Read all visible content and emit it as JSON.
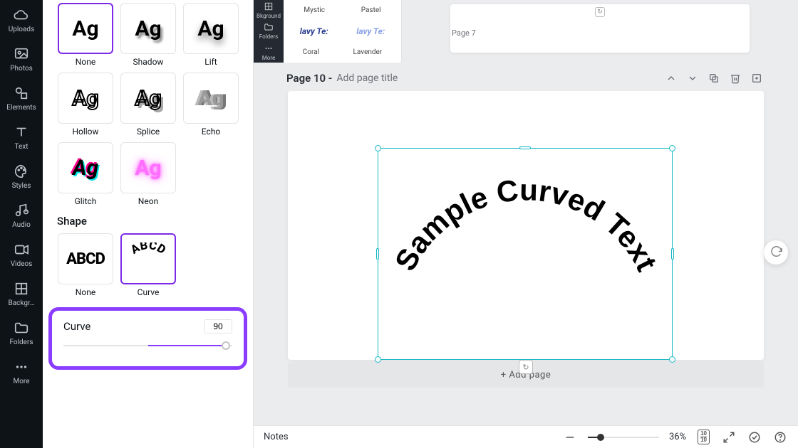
{
  "rail": [
    {
      "label": "Uploads",
      "icon": "cloud"
    },
    {
      "label": "Photos",
      "icon": "image"
    },
    {
      "label": "Elements",
      "icon": "shapes"
    },
    {
      "label": "Text",
      "icon": "text"
    },
    {
      "label": "Styles",
      "icon": "palette"
    },
    {
      "label": "Audio",
      "icon": "music"
    },
    {
      "label": "Videos",
      "icon": "video"
    },
    {
      "label": "Backgr…",
      "icon": "grid"
    },
    {
      "label": "Folders",
      "icon": "folder"
    },
    {
      "label": "More",
      "icon": "dots"
    }
  ],
  "mini_rail": [
    {
      "label": "Bkground",
      "icon": "grid"
    },
    {
      "label": "Folders",
      "icon": "folder"
    },
    {
      "label": "More",
      "icon": "dots"
    }
  ],
  "effects": {
    "sample": "Ag",
    "row1": [
      {
        "name": "None",
        "fx": "fx-none",
        "sel": true
      },
      {
        "name": "Shadow",
        "fx": "fx-shadow"
      },
      {
        "name": "Lift",
        "fx": "fx-lift"
      }
    ],
    "row2": [
      {
        "name": "Hollow",
        "fx": "fx-hollow"
      },
      {
        "name": "Splice",
        "fx": "fx-splice"
      },
      {
        "name": "Echo",
        "fx": "fx-echo"
      }
    ],
    "row3": [
      {
        "name": "Glitch",
        "fx": "fx-glitch"
      },
      {
        "name": "Neon",
        "fx": "fx-neon"
      }
    ],
    "shape_title": "Shape",
    "shapes": [
      {
        "name": "None",
        "sel": false,
        "kind": "shape-none",
        "text": "ABCD"
      },
      {
        "name": "Curve",
        "sel": true,
        "kind": "shape-curve",
        "text": "ABCD"
      }
    ],
    "curve_label": "Curve",
    "curve_value": "90"
  },
  "tiny": {
    "mini1": "lavy Te:",
    "mini2": "lavy Te:",
    "c1": "Coral",
    "c2": "Lavender",
    "top1": "Mystic",
    "top2": "Pastel"
  },
  "page7": {
    "label": "Page 7"
  },
  "page_head": {
    "num": "Page 10 -",
    "placeholder": "Add page title"
  },
  "canvas": {
    "text": "Sample Curved Text"
  },
  "add_page": "+ Add page",
  "bottom": {
    "notes": "Notes",
    "zoom": "36%",
    "page_current": "10",
    "page_total": "10"
  }
}
